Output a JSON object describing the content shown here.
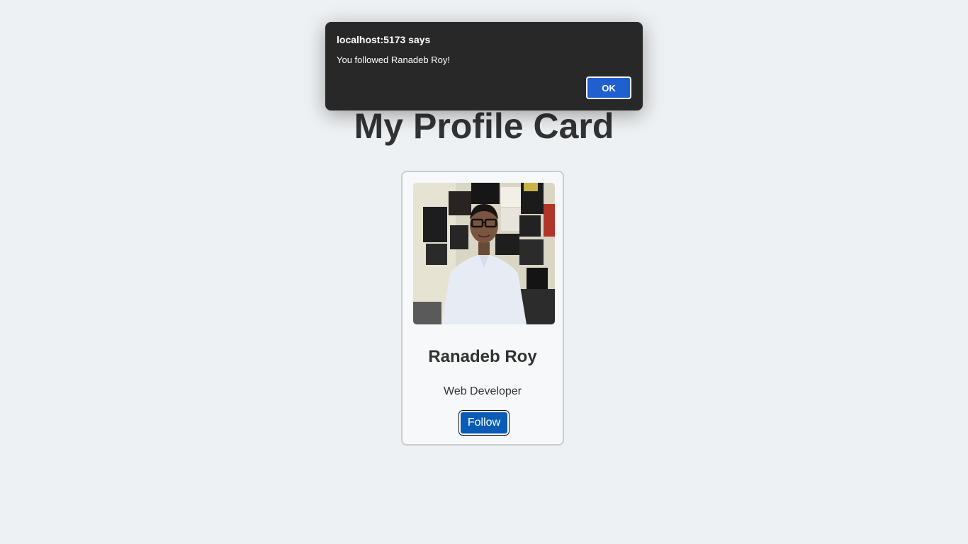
{
  "page": {
    "title": "My Profile Card"
  },
  "profile": {
    "name": "Ranadeb Roy",
    "role": "Web Developer",
    "follow_label": "Follow"
  },
  "dialog": {
    "origin": "localhost:5173 says",
    "message": "You followed Ranadeb Roy!",
    "ok_label": "OK"
  },
  "colors": {
    "background": "#eef1f3",
    "follow_button": "#0a5bb5",
    "dialog_background": "#282828",
    "dialog_ok": "#1f5fcf"
  }
}
